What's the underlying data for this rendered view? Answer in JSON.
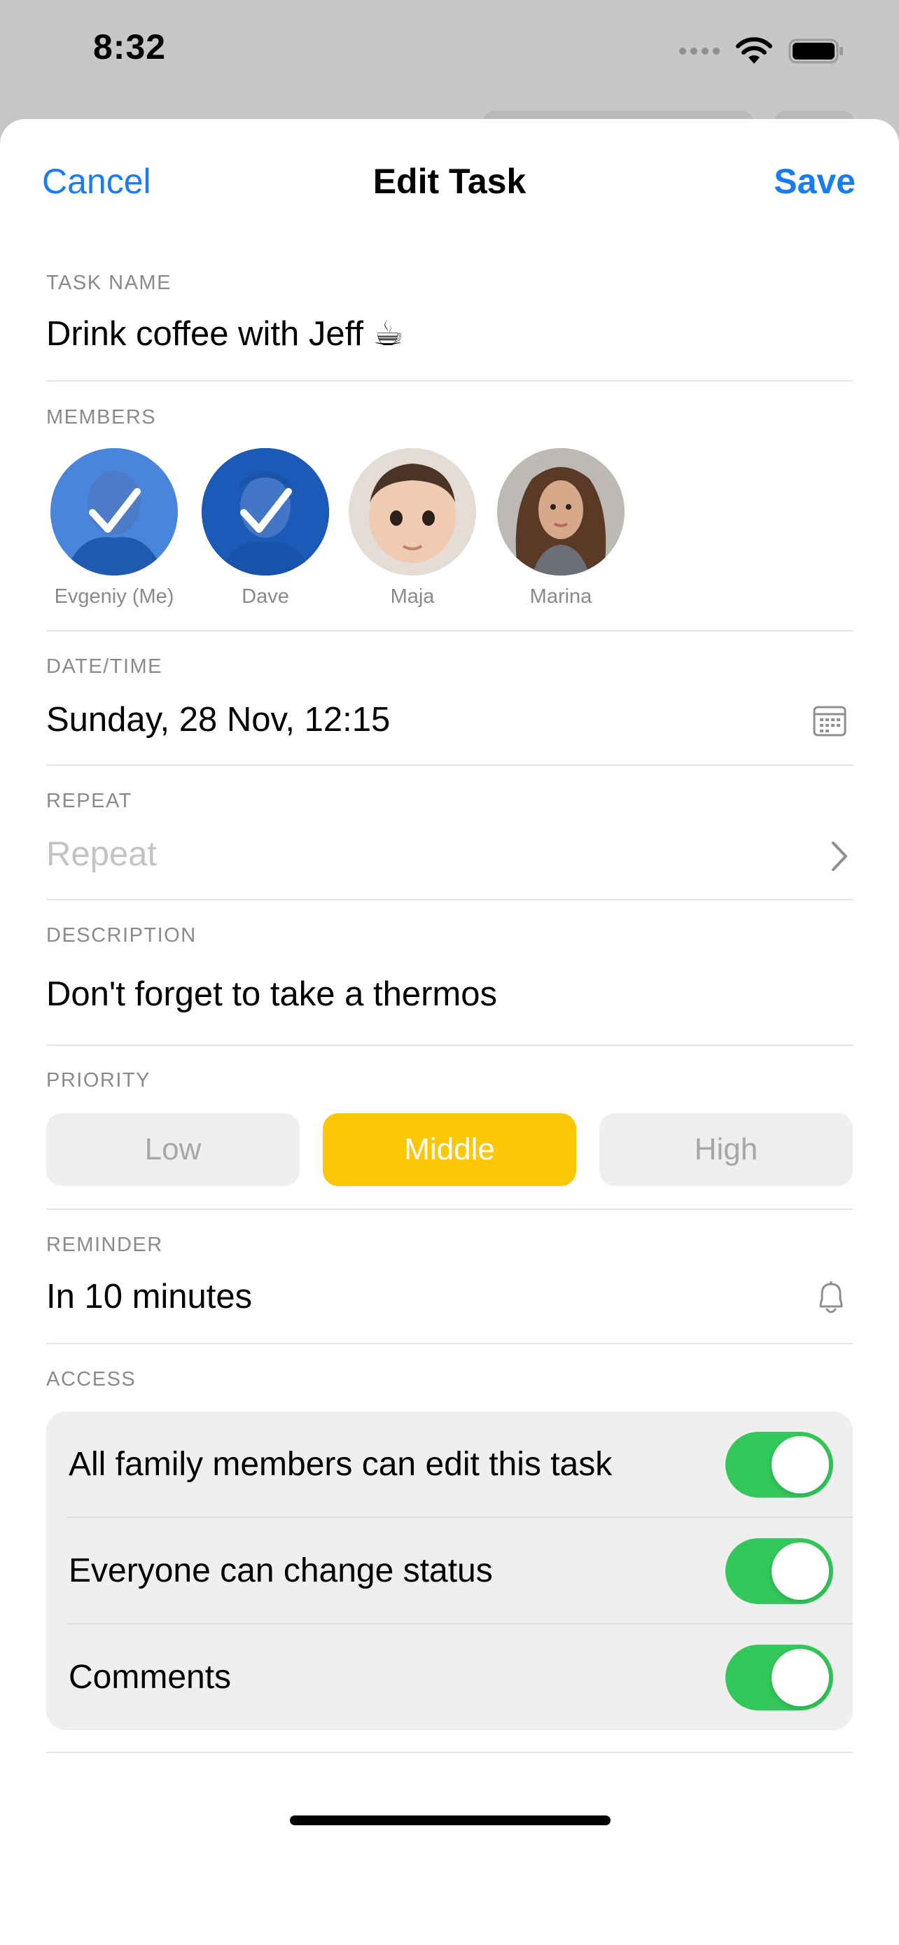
{
  "status_bar": {
    "time": "8:32",
    "icons": [
      "cellular-icon",
      "wifi-icon",
      "battery-icon"
    ]
  },
  "nav": {
    "cancel_label": "Cancel",
    "title": "Edit Task",
    "save_label": "Save"
  },
  "task_name": {
    "label": "TASK NAME",
    "value": "Drink coffee with Jeff ☕"
  },
  "members": {
    "label": "MEMBERS",
    "items": [
      {
        "name": "Evgeniy (Me)",
        "selected": true
      },
      {
        "name": "Dave",
        "selected": true
      },
      {
        "name": "Maja",
        "selected": false
      },
      {
        "name": "Marina",
        "selected": false
      }
    ]
  },
  "datetime": {
    "label": "DATE/TIME",
    "value": "Sunday, 28 Nov, 12:15",
    "icon": "calendar-icon"
  },
  "repeat": {
    "label": "REPEAT",
    "placeholder": "Repeat",
    "icon": "chevron-right-icon"
  },
  "description": {
    "label": "DESCRIPTION",
    "value": "Don't forget to take a thermos"
  },
  "priority": {
    "label": "PRIORITY",
    "options": [
      "Low",
      "Middle",
      "High"
    ],
    "selected": "Middle",
    "selected_color": "#FCC707"
  },
  "reminder": {
    "label": "REMINDER",
    "value": "In 10 minutes",
    "icon": "bell-icon"
  },
  "access": {
    "label": "ACCESS",
    "rows": [
      {
        "label": "All family members can edit this task",
        "enabled": true
      },
      {
        "label": "Everyone can change status",
        "enabled": true
      },
      {
        "label": "Comments",
        "enabled": true
      }
    ]
  },
  "colors": {
    "accent": "#1A7CF0",
    "toggle_on": "#34C759",
    "member_selected_overlay": "#1565D8"
  }
}
